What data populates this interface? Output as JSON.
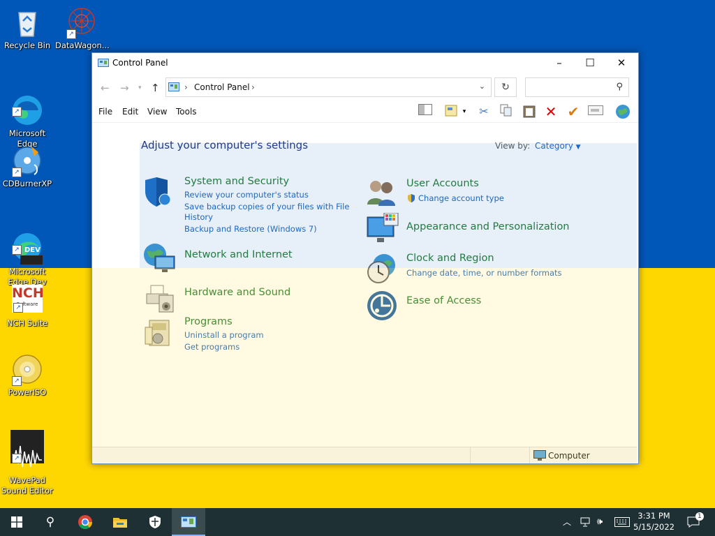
{
  "desktop": {
    "icons": [
      {
        "label": "Recycle Bin",
        "icon": "recycle-bin-icon"
      },
      {
        "label": "DataWagon...",
        "icon": "datawagon-icon"
      },
      {
        "label": "Microsoft\nEdge",
        "icon": "edge-icon"
      },
      {
        "label": "CDBurnerXP",
        "icon": "cdburner-icon"
      },
      {
        "label": "Microsoft\nEdge Dev",
        "icon": "edge-dev-icon"
      },
      {
        "label": "NCH Suite",
        "icon": "nch-icon"
      },
      {
        "label": "PowerISO",
        "icon": "poweriso-icon"
      },
      {
        "label": "WavePad\nSound Editor",
        "icon": "wavepad-icon"
      }
    ],
    "edge_dev_badge": "DEV",
    "nch_logo": "NCH",
    "nch_sub": "Software"
  },
  "window": {
    "title": "Control Panel",
    "breadcrumb": "Control Panel",
    "search_placeholder": "",
    "menus": [
      "File",
      "Edit",
      "View",
      "Tools"
    ],
    "heading": "Adjust your computer's settings",
    "viewby_label": "View by:",
    "viewby_value": "Category",
    "categories": {
      "system": {
        "name": "System and Security",
        "links": [
          "Review your computer's status",
          "Save backup copies of your files with File",
          "History",
          "Backup and Restore (Windows 7)"
        ]
      },
      "network": {
        "name": "Network and Internet"
      },
      "hardware": {
        "name": "Hardware and Sound"
      },
      "programs": {
        "name": "Programs",
        "links": [
          "Uninstall a program",
          "Get programs"
        ]
      },
      "users": {
        "name": "User Accounts",
        "links": [
          "Change account type"
        ]
      },
      "appearance": {
        "name": "Appearance and Personalization"
      },
      "clock": {
        "name": "Clock and Region",
        "links": [
          "Change date, time, or number formats"
        ]
      },
      "ease": {
        "name": "Ease of Access"
      }
    },
    "status_computer": "Computer"
  },
  "taskbar": {
    "time": "3:31 PM",
    "date": "5/15/2022",
    "notification_count": "1"
  },
  "colors": {
    "flag_blue": "#0057b7",
    "flag_yellow": "#ffd700",
    "category_green": "#1f7c2e",
    "link_blue": "#1a66c2",
    "heading_blue": "#1e3287",
    "taskbar": "#1f3034"
  }
}
